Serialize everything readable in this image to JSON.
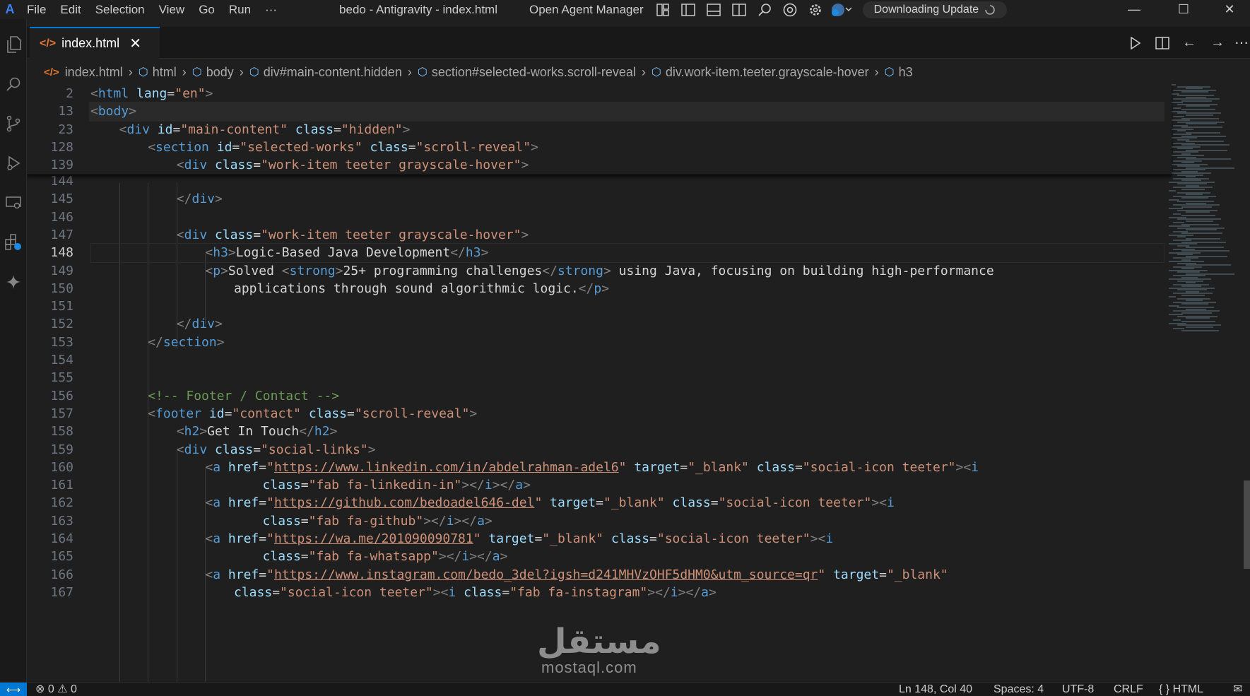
{
  "window": {
    "title": "bedo - Antigravity - index.html",
    "agent_manager": "Open Agent Manager",
    "update_label": "Downloading Update"
  },
  "menu": [
    "File",
    "Edit",
    "Selection",
    "View",
    "Go",
    "Run",
    "···"
  ],
  "tab": {
    "label": "index.html",
    "tag_icon": "</>"
  },
  "breadcrumb": [
    "index.html",
    "html",
    "body",
    "div#main-content.hidden",
    "section#selected-works.scroll-reveal",
    "div.work-item.teeter.grayscale-hover",
    "h3"
  ],
  "sticky_lines": [
    {
      "n": "2",
      "indent": 0,
      "tokens": [
        [
          "p",
          "<"
        ],
        [
          "tag",
          "html"
        ],
        [
          "txt",
          " "
        ],
        [
          "attr",
          "lang"
        ],
        [
          "txt",
          "="
        ],
        [
          "str",
          "\"en\""
        ],
        [
          "p",
          ">"
        ]
      ]
    },
    {
      "n": "13",
      "indent": 0,
      "tokens": [
        [
          "p",
          "<"
        ],
        [
          "tag",
          "body"
        ],
        [
          "p",
          ">"
        ]
      ]
    },
    {
      "n": "23",
      "indent": 4,
      "tokens": [
        [
          "p",
          "<"
        ],
        [
          "tag",
          "div"
        ],
        [
          "txt",
          " "
        ],
        [
          "attr",
          "id"
        ],
        [
          "txt",
          "="
        ],
        [
          "str",
          "\"main-content\""
        ],
        [
          "txt",
          " "
        ],
        [
          "attr",
          "class"
        ],
        [
          "txt",
          "="
        ],
        [
          "str",
          "\"hidden\""
        ],
        [
          "p",
          ">"
        ]
      ]
    },
    {
      "n": "128",
      "indent": 8,
      "tokens": [
        [
          "p",
          "<"
        ],
        [
          "tag",
          "section"
        ],
        [
          "txt",
          " "
        ],
        [
          "attr",
          "id"
        ],
        [
          "txt",
          "="
        ],
        [
          "str",
          "\"selected-works\""
        ],
        [
          "txt",
          " "
        ],
        [
          "attr",
          "class"
        ],
        [
          "txt",
          "="
        ],
        [
          "str",
          "\"scroll-reveal\""
        ],
        [
          "p",
          ">"
        ]
      ]
    },
    {
      "n": "139",
      "indent": 12,
      "tokens": [
        [
          "p",
          "<"
        ],
        [
          "tag",
          "div"
        ],
        [
          "txt",
          " "
        ],
        [
          "attr",
          "class"
        ],
        [
          "txt",
          "="
        ],
        [
          "str",
          "\"work-item teeter grayscale-hover\""
        ],
        [
          "p",
          ">"
        ]
      ]
    }
  ],
  "lines": [
    {
      "n": "144",
      "indent": 0,
      "tokens": []
    },
    {
      "n": "145",
      "indent": 12,
      "tokens": [
        [
          "p",
          "</"
        ],
        [
          "tag",
          "div"
        ],
        [
          "p",
          ">"
        ]
      ]
    },
    {
      "n": "146",
      "indent": 0,
      "tokens": []
    },
    {
      "n": "147",
      "indent": 12,
      "tokens": [
        [
          "p",
          "<"
        ],
        [
          "tag",
          "div"
        ],
        [
          "txt",
          " "
        ],
        [
          "attr",
          "class"
        ],
        [
          "txt",
          "="
        ],
        [
          "str",
          "\"work-item teeter grayscale-hover\""
        ],
        [
          "p",
          ">"
        ]
      ]
    },
    {
      "n": "148",
      "indent": 16,
      "current": true,
      "tokens": [
        [
          "p",
          "<"
        ],
        [
          "tag",
          "h3"
        ],
        [
          "p",
          ">"
        ],
        [
          "txt",
          "Logic-Based Java Development"
        ],
        [
          "p",
          "</"
        ],
        [
          "tag",
          "h3"
        ],
        [
          "p",
          ">"
        ]
      ]
    },
    {
      "n": "149",
      "indent": 16,
      "tokens": [
        [
          "p",
          "<"
        ],
        [
          "tag",
          "p"
        ],
        [
          "p",
          ">"
        ],
        [
          "txt",
          "Solved "
        ],
        [
          "p",
          "<"
        ],
        [
          "tag",
          "strong"
        ],
        [
          "p",
          ">"
        ],
        [
          "txt",
          "25+ programming challenges"
        ],
        [
          "p",
          "</"
        ],
        [
          "tag",
          "strong"
        ],
        [
          "p",
          ">"
        ],
        [
          "txt",
          " using Java, focusing on building high-performance"
        ]
      ]
    },
    {
      "n": "150",
      "indent": 20,
      "tokens": [
        [
          "txt",
          "applications through sound algorithmic logic."
        ],
        [
          "p",
          "</"
        ],
        [
          "tag",
          "p"
        ],
        [
          "p",
          ">"
        ]
      ]
    },
    {
      "n": "151",
      "indent": 0,
      "tokens": []
    },
    {
      "n": "152",
      "indent": 12,
      "tokens": [
        [
          "p",
          "</"
        ],
        [
          "tag",
          "div"
        ],
        [
          "p",
          ">"
        ]
      ]
    },
    {
      "n": "153",
      "indent": 8,
      "tokens": [
        [
          "p",
          "</"
        ],
        [
          "tag",
          "section"
        ],
        [
          "p",
          ">"
        ]
      ]
    },
    {
      "n": "154",
      "indent": 0,
      "tokens": []
    },
    {
      "n": "155",
      "indent": 0,
      "tokens": []
    },
    {
      "n": "156",
      "indent": 8,
      "tokens": [
        [
          "cmt",
          "<!-- Footer / Contact -->"
        ]
      ]
    },
    {
      "n": "157",
      "indent": 8,
      "tokens": [
        [
          "p",
          "<"
        ],
        [
          "tag",
          "footer"
        ],
        [
          "txt",
          " "
        ],
        [
          "attr",
          "id"
        ],
        [
          "txt",
          "="
        ],
        [
          "str",
          "\"contact\""
        ],
        [
          "txt",
          " "
        ],
        [
          "attr",
          "class"
        ],
        [
          "txt",
          "="
        ],
        [
          "str",
          "\"scroll-reveal\""
        ],
        [
          "p",
          ">"
        ]
      ]
    },
    {
      "n": "158",
      "indent": 12,
      "tokens": [
        [
          "p",
          "<"
        ],
        [
          "tag",
          "h2"
        ],
        [
          "p",
          ">"
        ],
        [
          "txt",
          "Get In Touch"
        ],
        [
          "p",
          "</"
        ],
        [
          "tag",
          "h2"
        ],
        [
          "p",
          ">"
        ]
      ]
    },
    {
      "n": "159",
      "indent": 12,
      "tokens": [
        [
          "p",
          "<"
        ],
        [
          "tag",
          "div"
        ],
        [
          "txt",
          " "
        ],
        [
          "attr",
          "class"
        ],
        [
          "txt",
          "="
        ],
        [
          "str",
          "\"social-links\""
        ],
        [
          "p",
          ">"
        ]
      ]
    },
    {
      "n": "160",
      "indent": 16,
      "tokens": [
        [
          "p",
          "<"
        ],
        [
          "tag",
          "a"
        ],
        [
          "txt",
          " "
        ],
        [
          "attr",
          "href"
        ],
        [
          "txt",
          "="
        ],
        [
          "str",
          "\""
        ],
        [
          "url",
          "https://www.linkedin.com/in/abdelrahman-adel6"
        ],
        [
          "str",
          "\""
        ],
        [
          "txt",
          " "
        ],
        [
          "attr",
          "target"
        ],
        [
          "txt",
          "="
        ],
        [
          "str",
          "\"_blank\""
        ],
        [
          "txt",
          " "
        ],
        [
          "attr",
          "class"
        ],
        [
          "txt",
          "="
        ],
        [
          "str",
          "\"social-icon teeter\""
        ],
        [
          "p",
          "><"
        ],
        [
          "tag",
          "i"
        ]
      ]
    },
    {
      "n": "161",
      "indent": 24,
      "tokens": [
        [
          "attr",
          "class"
        ],
        [
          "txt",
          "="
        ],
        [
          "str",
          "\"fab fa-linkedin-in\""
        ],
        [
          "p",
          "></"
        ],
        [
          "tag",
          "i"
        ],
        [
          "p",
          "></"
        ],
        [
          "tag",
          "a"
        ],
        [
          "p",
          ">"
        ]
      ]
    },
    {
      "n": "162",
      "indent": 16,
      "tokens": [
        [
          "p",
          "<"
        ],
        [
          "tag",
          "a"
        ],
        [
          "txt",
          " "
        ],
        [
          "attr",
          "href"
        ],
        [
          "txt",
          "="
        ],
        [
          "str",
          "\""
        ],
        [
          "url",
          "https://github.com/bedoadel646-del"
        ],
        [
          "str",
          "\""
        ],
        [
          "txt",
          " "
        ],
        [
          "attr",
          "target"
        ],
        [
          "txt",
          "="
        ],
        [
          "str",
          "\"_blank\""
        ],
        [
          "txt",
          " "
        ],
        [
          "attr",
          "class"
        ],
        [
          "txt",
          "="
        ],
        [
          "str",
          "\"social-icon teeter\""
        ],
        [
          "p",
          "><"
        ],
        [
          "tag",
          "i"
        ]
      ]
    },
    {
      "n": "163",
      "indent": 24,
      "tokens": [
        [
          "attr",
          "class"
        ],
        [
          "txt",
          "="
        ],
        [
          "str",
          "\"fab fa-github\""
        ],
        [
          "p",
          "></"
        ],
        [
          "tag",
          "i"
        ],
        [
          "p",
          "></"
        ],
        [
          "tag",
          "a"
        ],
        [
          "p",
          ">"
        ]
      ]
    },
    {
      "n": "164",
      "indent": 16,
      "tokens": [
        [
          "p",
          "<"
        ],
        [
          "tag",
          "a"
        ],
        [
          "txt",
          " "
        ],
        [
          "attr",
          "href"
        ],
        [
          "txt",
          "="
        ],
        [
          "str",
          "\""
        ],
        [
          "url",
          "https://wa.me/201090090781"
        ],
        [
          "str",
          "\""
        ],
        [
          "txt",
          " "
        ],
        [
          "attr",
          "target"
        ],
        [
          "txt",
          "="
        ],
        [
          "str",
          "\"_blank\""
        ],
        [
          "txt",
          " "
        ],
        [
          "attr",
          "class"
        ],
        [
          "txt",
          "="
        ],
        [
          "str",
          "\"social-icon teeter\""
        ],
        [
          "p",
          "><"
        ],
        [
          "tag",
          "i"
        ]
      ]
    },
    {
      "n": "165",
      "indent": 24,
      "tokens": [
        [
          "attr",
          "class"
        ],
        [
          "txt",
          "="
        ],
        [
          "str",
          "\"fab fa-whatsapp\""
        ],
        [
          "p",
          "></"
        ],
        [
          "tag",
          "i"
        ],
        [
          "p",
          "></"
        ],
        [
          "tag",
          "a"
        ],
        [
          "p",
          ">"
        ]
      ]
    },
    {
      "n": "166",
      "indent": 16,
      "tokens": [
        [
          "p",
          "<"
        ],
        [
          "tag",
          "a"
        ],
        [
          "txt",
          " "
        ],
        [
          "attr",
          "href"
        ],
        [
          "txt",
          "="
        ],
        [
          "str",
          "\""
        ],
        [
          "url",
          "https://www.instagram.com/bedo_3del?igsh=d241MHVzOHF5dHM0&utm_source=qr"
        ],
        [
          "str",
          "\""
        ],
        [
          "txt",
          " "
        ],
        [
          "attr",
          "target"
        ],
        [
          "txt",
          "="
        ],
        [
          "str",
          "\"_blank\""
        ]
      ]
    },
    {
      "n": "167",
      "indent": 20,
      "tokens": [
        [
          "attr",
          "class"
        ],
        [
          "txt",
          "="
        ],
        [
          "str",
          "\"social-icon teeter\""
        ],
        [
          "p",
          "><"
        ],
        [
          "tag",
          "i"
        ],
        [
          "txt",
          " "
        ],
        [
          "attr",
          "class"
        ],
        [
          "txt",
          "="
        ],
        [
          "str",
          "\"fab fa-instagram\""
        ],
        [
          "p",
          "></"
        ],
        [
          "tag",
          "i"
        ],
        [
          "p",
          "></"
        ],
        [
          "tag",
          "a"
        ],
        [
          "p",
          ">"
        ]
      ]
    }
  ],
  "status": {
    "errors": "0",
    "warnings": "0",
    "position": "Ln 148, Col 40",
    "spaces": "Spaces: 4",
    "encoding": "UTF-8",
    "eol": "CRLF",
    "language": "HTML"
  },
  "watermark": {
    "arabic": "مستقل",
    "latin": "mostaql.com"
  },
  "colors": {
    "accent": "#0078d4",
    "tag": "#569cd6",
    "attribute": "#9cdcfe",
    "string": "#ce9178",
    "comment": "#6a9955",
    "text": "#d4d4d4",
    "html_icon": "#e37933"
  },
  "icons": {
    "activity": [
      "explorer-icon",
      "search-icon",
      "source-control-icon",
      "run-debug-icon",
      "remote-explorer-icon",
      "extensions-icon",
      "agent-sparkle-icon"
    ],
    "titlebar": [
      "layout-icon",
      "toggle-sidebar-icon",
      "toggle-panel-icon",
      "toggle-secondary-sidebar-icon",
      "search-icon",
      "chrome-icon",
      "settings-icon",
      "account-icon"
    ],
    "editor_actions": [
      "run-icon",
      "split-editor-icon",
      "back-icon",
      "forward-icon",
      "more-icon"
    ]
  }
}
